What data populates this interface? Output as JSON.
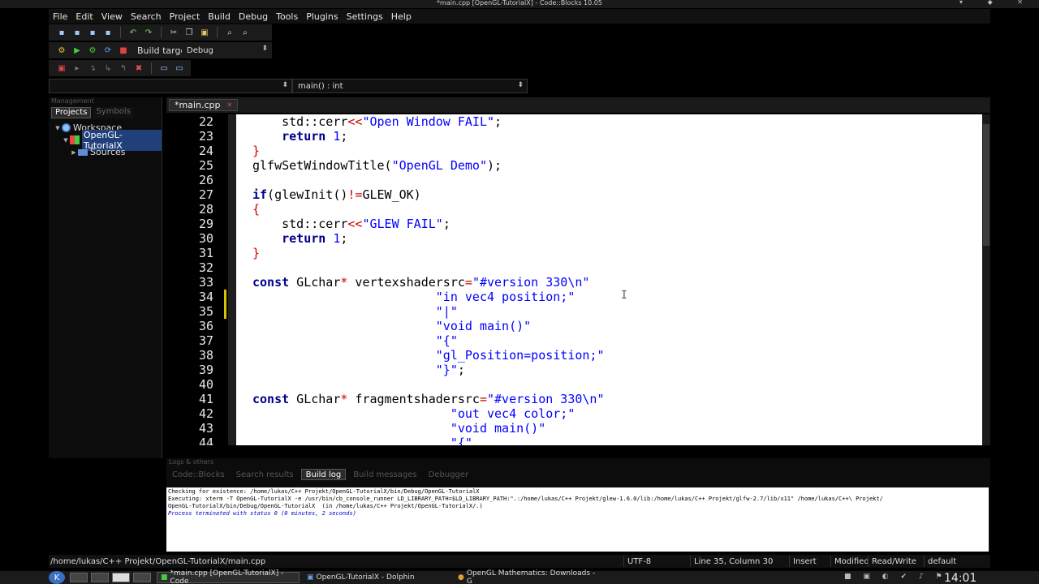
{
  "window": {
    "title": "*main.cpp [OpenGL-TutorialX] - Code::Blocks 10.05",
    "controls": "▾ ◆ ✕"
  },
  "menu": [
    "File",
    "Edit",
    "View",
    "Search",
    "Project",
    "Build",
    "Debug",
    "Tools",
    "Plugins",
    "Settings",
    "Help"
  ],
  "toolbar": {
    "build_target_label": "Build target:",
    "build_target_value": "Debug"
  },
  "code_nav": {
    "scope_value": "",
    "function_value": "main() : int"
  },
  "management": {
    "header": "Management",
    "tabs": [
      "Projects",
      "Symbols"
    ],
    "tree": {
      "workspace": "Workspace",
      "project": "OpenGL-TutorialX",
      "sources": "Sources"
    }
  },
  "editor": {
    "tab_label": "*main.cpp",
    "lines": [
      {
        "n": "22",
        "html": "    std::cerr<span class='op'>&lt;&lt;</span><span class='str'>\"Open Window FAIL\"</span>;"
      },
      {
        "n": "23",
        "html": "    <span class='kw'>return</span> <span class='str'>1</span>;"
      },
      {
        "n": "24",
        "html": "<span class='op'>}</span>"
      },
      {
        "n": "25",
        "html": "glfwSetWindowTitle(<span class='str'>\"OpenGL Demo\"</span>);"
      },
      {
        "n": "26",
        "html": ""
      },
      {
        "n": "27",
        "html": "<span class='kw'>if</span>(glewInit()<span class='op'>!=</span>GLEW_OK)"
      },
      {
        "n": "28",
        "html": "<span class='op'>{</span>"
      },
      {
        "n": "29",
        "html": "    std::cerr<span class='op'>&lt;&lt;</span><span class='str'>\"GLEW FAIL\"</span>;"
      },
      {
        "n": "30",
        "html": "    <span class='kw'>return</span> <span class='str'>1</span>;"
      },
      {
        "n": "31",
        "html": "<span class='op'>}</span>"
      },
      {
        "n": "32",
        "html": ""
      },
      {
        "n": "33",
        "html": "<span class='kw'>const</span> GLchar<span class='op'>*</span> vertexshadersrc<span class='op'>=</span><span class='str'>\"#version 330\\n\"</span>"
      },
      {
        "n": "34",
        "html": "                         <span class='str'>\"in vec4 position;\"</span>"
      },
      {
        "n": "35",
        "html": "                         <span class='str'>\"|\"</span>"
      },
      {
        "n": "36",
        "html": "                         <span class='str'>\"void main()\"</span>"
      },
      {
        "n": "37",
        "html": "                         <span class='str'>\"{\"</span>"
      },
      {
        "n": "38",
        "html": "                         <span class='str'>\"gl_Position=position;\"</span>"
      },
      {
        "n": "39",
        "html": "                         <span class='str'>\"}\"</span>;"
      },
      {
        "n": "40",
        "html": ""
      },
      {
        "n": "41",
        "html": "<span class='kw'>const</span> GLchar<span class='op'>*</span> fragmentshadersrc<span class='op'>=</span><span class='str'>\"#version 330\\n\"</span>"
      },
      {
        "n": "42",
        "html": "                           <span class='str'>\"out vec4 color;\"</span>"
      },
      {
        "n": "43",
        "html": "                           <span class='str'>\"void main()\"</span>"
      },
      {
        "n": "44",
        "html": "                           <span class='str'>\"{\"</span>"
      }
    ]
  },
  "logs": {
    "header": "Logs & others",
    "tabs": [
      "Code::Blocks",
      "Search results",
      "Build log",
      "Build messages",
      "Debugger"
    ],
    "active_tab": "Build log",
    "lines": [
      "Checking for existence: /home/lukas/C++ Projekt/OpenGL-TutorialX/bin/Debug/OpenGL-TutorialX",
      "Executing: xterm -T OpenGL-TutorialX -e /usr/bin/cb_console_runner LD_LIBRARY_PATH=$LD_LIBRARY_PATH:\".:/home/lukas/C++ Projekt/glew-1.6.0/lib:/home/lukas/C++ Projekt/glfw-2.7/lib/x11\" /home/lukas/C++\\ Projekt/",
      "OpenGL-TutorialX/bin/Debug/OpenGL-TutorialX  (in /home/lukas/C++ Projekt/OpenGL-TutorialX/.)",
      "Process terminated with status 0 (0 minutes, 2 seconds)"
    ]
  },
  "status": {
    "path": "/home/lukas/C++ Projekt/OpenGL-TutorialX/main.cpp",
    "encoding": "UTF-8",
    "position": "Line 35, Column 30",
    "mode": "Insert",
    "modified": "Modified",
    "access": "Read/Write",
    "profile": "default"
  },
  "taskbar": {
    "tasks": [
      "*main.cpp [OpenGL-TutorialX] - Code",
      "OpenGL-TutorialX - Dolphin",
      "OpenGL Mathematics: Downloads - G"
    ],
    "clock": "14:01"
  }
}
